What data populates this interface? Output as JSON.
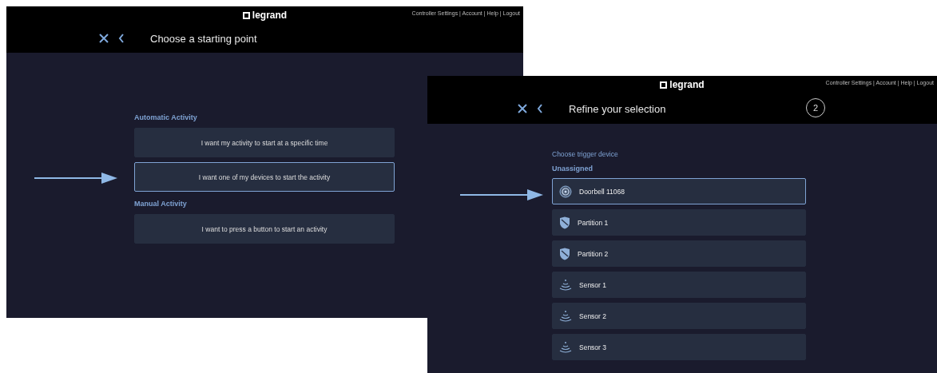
{
  "windows": [
    {
      "logo": "legrand",
      "top_links": "Controller Settings | Account | Help | Logout",
      "title": "Choose a starting point",
      "groups": [
        {
          "heading": "Automatic Activity",
          "options": [
            {
              "label": "I want my activity to start at a specific time",
              "selected": false
            },
            {
              "label": "I want one of my devices to start the activity",
              "selected": true
            }
          ]
        },
        {
          "heading": "Manual Activity",
          "options": [
            {
              "label": "I want to press a button to start an activity",
              "selected": false
            }
          ]
        }
      ]
    },
    {
      "logo": "legrand",
      "top_links": "Controller Settings | Account | Help | Logout",
      "title": "Refine your selection",
      "step": "2",
      "prompt": "Choose trigger device",
      "section": "Unassigned",
      "devices": [
        {
          "name": "Doorbell 11068",
          "kind": "doorbell",
          "selected": true
        },
        {
          "name": "Partition 1",
          "kind": "partition",
          "selected": false
        },
        {
          "name": "Partition 2",
          "kind": "partition",
          "selected": false
        },
        {
          "name": "Sensor 1",
          "kind": "sensor",
          "selected": false
        },
        {
          "name": "Sensor 2",
          "kind": "sensor",
          "selected": false
        },
        {
          "name": "Sensor 3",
          "kind": "sensor",
          "selected": false
        }
      ]
    }
  ]
}
